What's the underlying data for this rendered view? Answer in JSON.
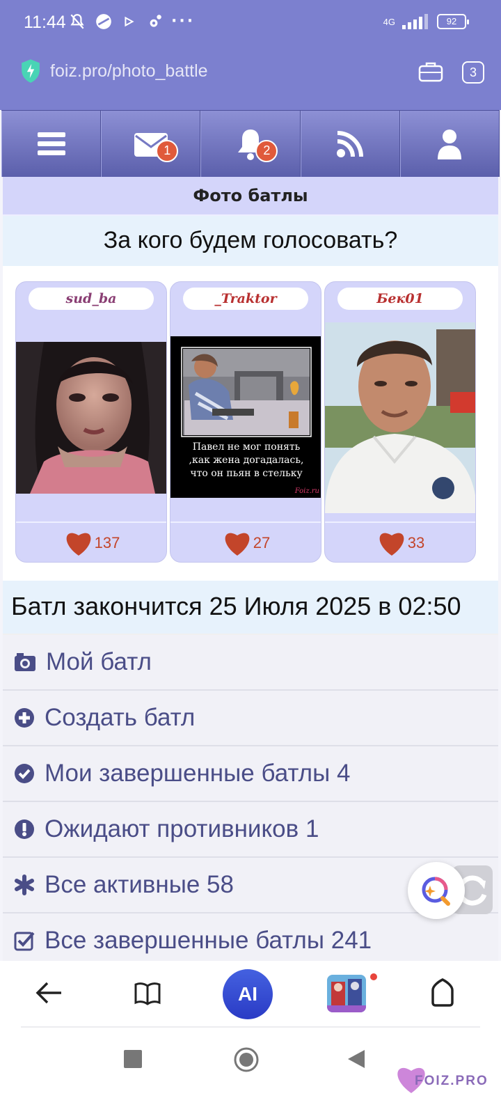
{
  "status_bar": {
    "time": "11:44",
    "network": "4G",
    "battery": "92"
  },
  "browser": {
    "url": "foiz.pro/photo_battle",
    "tabs_count": "3"
  },
  "site_nav": {
    "messages_badge": "1",
    "notifications_badge": "2"
  },
  "page": {
    "title": "Фото батлы",
    "question": "За кого будем голосовать?",
    "cards": [
      {
        "name": "sud_ba",
        "votes": "137"
      },
      {
        "name": "_Traktor",
        "votes": "27",
        "caption": [
          "Павел не мог понять",
          ",как жена догадалась,",
          "что он пьян в стельку"
        ],
        "watermark": "Foiz.ru"
      },
      {
        "name": "Бек01",
        "votes": "33"
      }
    ],
    "battle_end": "Батл закончится 25 Июля 2025 в 02:50",
    "menu": [
      {
        "label": "Мой батл",
        "icon": "camera-icon"
      },
      {
        "label": "Создать батл",
        "icon": "plus-circle-icon"
      },
      {
        "label": "Мои завершенные батлы 4",
        "icon": "check-circle-icon"
      },
      {
        "label": "Ожидают противников 1",
        "icon": "exclamation-circle-icon"
      },
      {
        "label": "Все активные 58",
        "icon": "asterisk-icon"
      },
      {
        "label": "Все завершенные батлы 241",
        "icon": "checkbox-icon"
      }
    ]
  },
  "bottom_bar": {
    "ai_label": "AI"
  },
  "watermark": "FOIZ.PRO",
  "colors": {
    "header": "#7c80cf",
    "accent": "#5b5fab",
    "heart": "#c3452a",
    "menu_text": "#4a4d87"
  }
}
